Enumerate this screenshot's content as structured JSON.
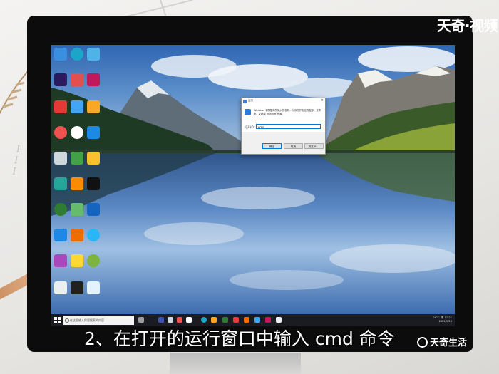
{
  "watermark_top": "天奇·视频",
  "watermark_bottom": "天奇生活",
  "caption": "2、在打开的运行窗口中输入 cmd 命令",
  "colors": {
    "monitor_bezel": "#0c0c0d",
    "taskbar": "#1a1c22",
    "accent": "#0078d7"
  },
  "run_dialog": {
    "title": "运行",
    "close_glyph": "×",
    "description": "Windows 将根据你所输入的名称，为你打开相应的程序、文件夹、文档或 Internet 资源。",
    "open_label": "打开(O):",
    "input_value": "cmd",
    "buttons": {
      "ok": "确定",
      "cancel": "取消",
      "browse": "浏览(B)..."
    }
  },
  "taskbar": {
    "search_placeholder": "在这里输入你要搜索的内容",
    "tray_temp": "16°C 晴",
    "tray_time": "11:21",
    "tray_date": "2022/5/26"
  }
}
